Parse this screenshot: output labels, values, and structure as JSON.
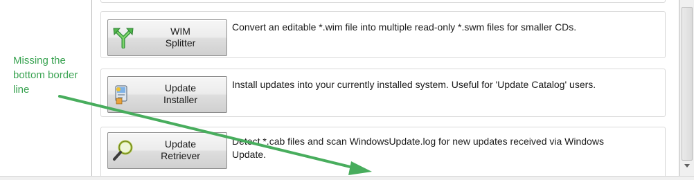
{
  "tools": [
    {
      "label_line1": "WIM",
      "label_line2": "Splitter",
      "icon": "wim-splitter-icon",
      "description": "Convert an editable *.wim file into multiple read-only *.swm files for smaller CDs."
    },
    {
      "label_line1": "Update",
      "label_line2": "Installer",
      "icon": "update-installer-icon",
      "description": "Install updates into your currently installed system. Useful for 'Update Catalog' users."
    },
    {
      "label_line1": "Update",
      "label_line2": "Retriever",
      "icon": "magnifier-icon",
      "description_line1": "Detect *.cab files and scan WindowsUpdate.log for new updates received via Windows",
      "description_line2": "Update."
    }
  ],
  "annotation": {
    "text_line1": "Missing the",
    "text_line2": "bottom border",
    "text_line3": "line",
    "color": "#3aa352"
  },
  "colors": {
    "card_border": "#d9d9d9",
    "button_border": "#8e8e8e",
    "annotation_green": "#3aa352"
  }
}
